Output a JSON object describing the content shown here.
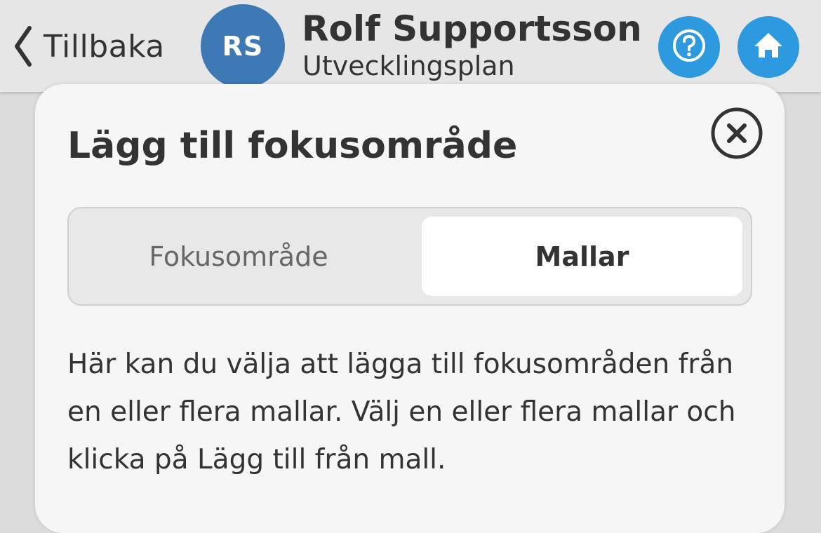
{
  "header": {
    "back_label": "Tillbaka",
    "avatar_initials": "RS",
    "user_name": "Rolf Supportsson",
    "subtitle": "Utvecklingsplan",
    "help_icon": "help-circle-icon",
    "home_icon": "home-icon",
    "accent_color": "#2d9ae0",
    "avatar_color": "#3d79b4"
  },
  "modal": {
    "title": "Lägg till fokusområde",
    "close_icon": "close-circle-icon",
    "tabs": [
      {
        "label": "Fokusområde",
        "selected": false
      },
      {
        "label": "Mallar",
        "selected": true
      }
    ],
    "description": "Här kan du välja att lägga till fokusområden från en eller flera mallar. Välj en eller flera mallar och klicka på Lägg till från mall."
  }
}
